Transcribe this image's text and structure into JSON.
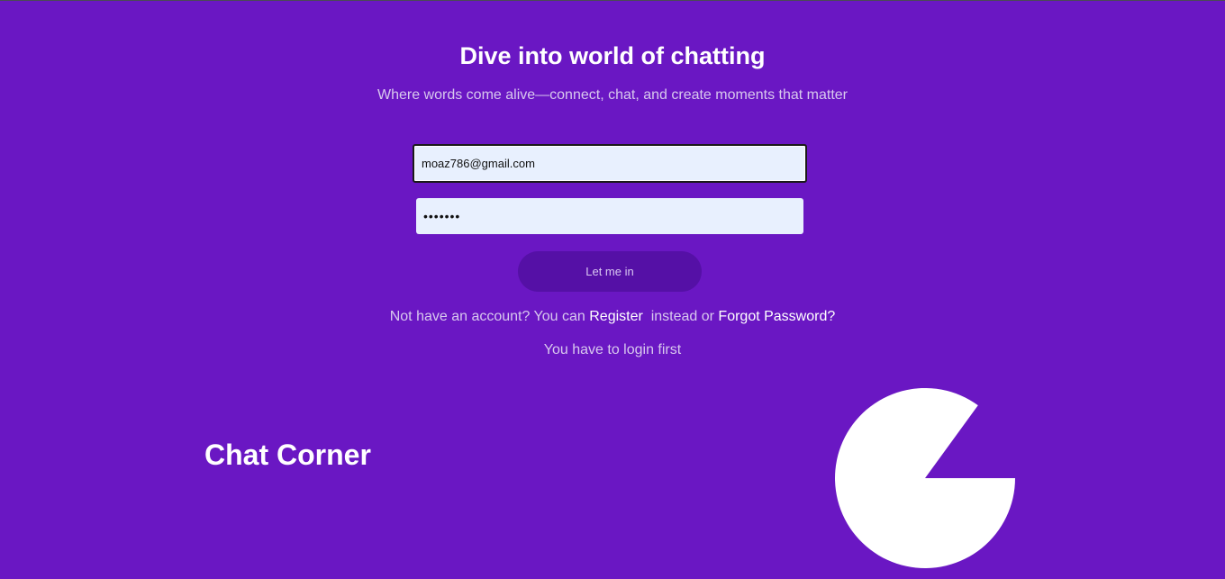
{
  "header": {
    "title": "Dive into world of chatting",
    "subtitle": "Where words come alive—connect, chat, and create moments that matter"
  },
  "form": {
    "email_value": "moaz786@gmail.com",
    "password_value": "•••••••",
    "submit_label": "Let me in"
  },
  "links": {
    "prefix": "Not have an account? You can ",
    "register_label": "Register",
    "middle": "  instead or ",
    "forgot_label": "Forgot Password?"
  },
  "status": {
    "message": "You have to login first"
  },
  "brand": {
    "name": "Chat Corner"
  },
  "decor": {
    "icon": "pacman-icon",
    "color": "#ffffff"
  },
  "colors": {
    "background": "#6a17c3",
    "button": "#5510a6",
    "input_bg": "#e8f0fe"
  }
}
